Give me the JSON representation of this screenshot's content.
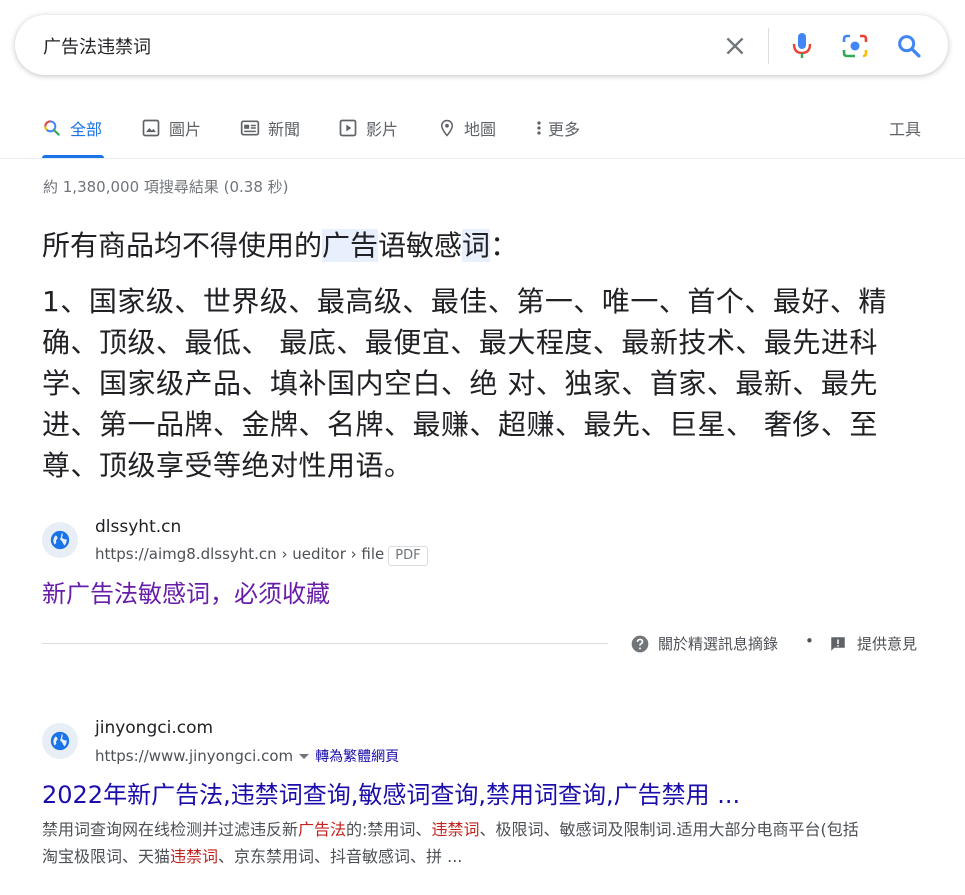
{
  "search": {
    "query": "广告法违禁词"
  },
  "tabs": [
    {
      "label": "全部",
      "icon": "search-icon",
      "active": true
    },
    {
      "label": "圖片",
      "icon": "image-icon"
    },
    {
      "label": "新聞",
      "icon": "news-icon"
    },
    {
      "label": "影片",
      "icon": "video-icon"
    },
    {
      "label": "地圖",
      "icon": "map-pin-icon"
    },
    {
      "label": "更多",
      "icon": "more-vert-icon"
    }
  ],
  "tools_label": "工具",
  "stats": "約 1,380,000 項搜尋結果 (0.38 秒)",
  "snippet": {
    "heading_pre": "所有商品均不得使用的",
    "heading_hl1": "广告",
    "heading_mid": "语敏感",
    "heading_hl2": "词",
    "heading_post": "：",
    "body": "1、国家级、世界级、最高级、最佳、第一、唯一、首个、最好、精确、顶级、最低、 最底、最便宜、最大程度、最新技术、最先进科学、国家级产品、填补国内空白、绝 对、独家、首家、最新、最先进、第一品牌、金牌、名牌、最赚、超赚、最先、巨星、 奢侈、至尊、顶级享受等绝对性用语。"
  },
  "featured_source": {
    "site_name": "dlssyht.cn",
    "url": "https://aimg8.dlssyht.cn › ueditor › file",
    "badge": "PDF",
    "title": "新广告法敏感词，必须收藏"
  },
  "featured_footer": {
    "about": "關於精選訊息摘錄",
    "separator": "•",
    "feedback": "提供意見"
  },
  "result": {
    "site_name": "jinyongci.com",
    "url": "https://www.jinyongci.com",
    "translate": "轉為繁體網頁",
    "title": "2022年新广告法,违禁词查询,敏感词查询,禁用词查询,广告禁用 ...",
    "desc_1": "禁用词查询网在线检测并过滤违反新",
    "desc_em1": "广告法",
    "desc_2": "的:禁用词、",
    "desc_em2": "违禁词",
    "desc_3": "、极限词、敏感词及限制词.适用大部分电商平台(包括淘宝极限词、天猫",
    "desc_em3": "违禁词",
    "desc_4": "、京东禁用词、抖音敏感词、拼 ..."
  },
  "colors": {
    "link": "#1a0dab",
    "visited": "#681da8",
    "active_tab": "#1a73e8",
    "highlight": "#e8f0fe",
    "emphasis": "#c5221f"
  }
}
